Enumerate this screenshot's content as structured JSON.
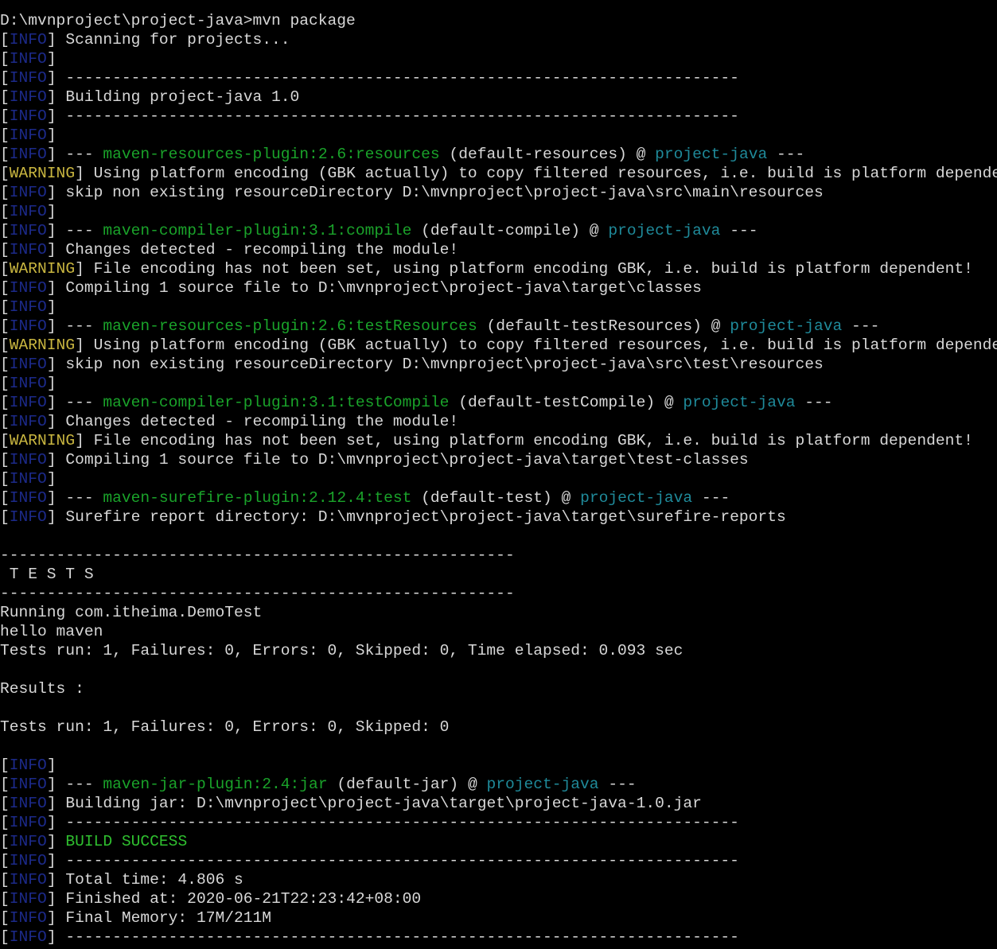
{
  "colors": {
    "default": "#d8d8d8",
    "info": "#1c2a8a",
    "warning": "#c9b640",
    "plugin": "#1aa32a",
    "project": "#1f8a9a",
    "success": "#2fbf2f"
  },
  "lines": [
    [
      {
        "t": "D:\\mvnproject\\project-java>mvn package",
        "c": "default"
      }
    ],
    [
      {
        "t": "[",
        "c": "default"
      },
      {
        "t": "INFO",
        "c": "info"
      },
      {
        "t": "] Scanning for projects...",
        "c": "default"
      }
    ],
    [
      {
        "t": "[",
        "c": "default"
      },
      {
        "t": "INFO",
        "c": "info"
      },
      {
        "t": "]",
        "c": "default"
      }
    ],
    [
      {
        "t": "[",
        "c": "default"
      },
      {
        "t": "INFO",
        "c": "info"
      },
      {
        "t": "] ------------------------------------------------------------------------",
        "c": "default"
      }
    ],
    [
      {
        "t": "[",
        "c": "default"
      },
      {
        "t": "INFO",
        "c": "info"
      },
      {
        "t": "] Building project-java 1.0",
        "c": "default"
      }
    ],
    [
      {
        "t": "[",
        "c": "default"
      },
      {
        "t": "INFO",
        "c": "info"
      },
      {
        "t": "] ------------------------------------------------------------------------",
        "c": "default"
      }
    ],
    [
      {
        "t": "[",
        "c": "default"
      },
      {
        "t": "INFO",
        "c": "info"
      },
      {
        "t": "]",
        "c": "default"
      }
    ],
    [
      {
        "t": "[",
        "c": "default"
      },
      {
        "t": "INFO",
        "c": "info"
      },
      {
        "t": "] --- ",
        "c": "default"
      },
      {
        "t": "maven-resources-plugin:2.6:resources",
        "c": "plugin"
      },
      {
        "t": " (default-resources) @ ",
        "c": "default"
      },
      {
        "t": "project-java",
        "c": "project"
      },
      {
        "t": " ---",
        "c": "default"
      }
    ],
    [
      {
        "t": "[",
        "c": "default"
      },
      {
        "t": "WARNING",
        "c": "warning"
      },
      {
        "t": "] Using platform encoding (GBK actually) to copy filtered resources, i.e. build is platform dependent!",
        "c": "default"
      }
    ],
    [
      {
        "t": "[",
        "c": "default"
      },
      {
        "t": "INFO",
        "c": "info"
      },
      {
        "t": "] skip non existing resourceDirectory D:\\mvnproject\\project-java\\src\\main\\resources",
        "c": "default"
      }
    ],
    [
      {
        "t": "[",
        "c": "default"
      },
      {
        "t": "INFO",
        "c": "info"
      },
      {
        "t": "]",
        "c": "default"
      }
    ],
    [
      {
        "t": "[",
        "c": "default"
      },
      {
        "t": "INFO",
        "c": "info"
      },
      {
        "t": "] --- ",
        "c": "default"
      },
      {
        "t": "maven-compiler-plugin:3.1:compile",
        "c": "plugin"
      },
      {
        "t": " (default-compile) @ ",
        "c": "default"
      },
      {
        "t": "project-java",
        "c": "project"
      },
      {
        "t": " ---",
        "c": "default"
      }
    ],
    [
      {
        "t": "[",
        "c": "default"
      },
      {
        "t": "INFO",
        "c": "info"
      },
      {
        "t": "] Changes detected - recompiling the module!",
        "c": "default"
      }
    ],
    [
      {
        "t": "[",
        "c": "default"
      },
      {
        "t": "WARNING",
        "c": "warning"
      },
      {
        "t": "] File encoding has not been set, using platform encoding GBK, i.e. build is platform dependent!",
        "c": "default"
      }
    ],
    [
      {
        "t": "[",
        "c": "default"
      },
      {
        "t": "INFO",
        "c": "info"
      },
      {
        "t": "] Compiling 1 source file to D:\\mvnproject\\project-java\\target\\classes",
        "c": "default"
      }
    ],
    [
      {
        "t": "[",
        "c": "default"
      },
      {
        "t": "INFO",
        "c": "info"
      },
      {
        "t": "]",
        "c": "default"
      }
    ],
    [
      {
        "t": "[",
        "c": "default"
      },
      {
        "t": "INFO",
        "c": "info"
      },
      {
        "t": "] --- ",
        "c": "default"
      },
      {
        "t": "maven-resources-plugin:2.6:testResources",
        "c": "plugin"
      },
      {
        "t": " (default-testResources) @ ",
        "c": "default"
      },
      {
        "t": "project-java",
        "c": "project"
      },
      {
        "t": " ---",
        "c": "default"
      }
    ],
    [
      {
        "t": "[",
        "c": "default"
      },
      {
        "t": "WARNING",
        "c": "warning"
      },
      {
        "t": "] Using platform encoding (GBK actually) to copy filtered resources, i.e. build is platform dependent!",
        "c": "default"
      }
    ],
    [
      {
        "t": "[",
        "c": "default"
      },
      {
        "t": "INFO",
        "c": "info"
      },
      {
        "t": "] skip non existing resourceDirectory D:\\mvnproject\\project-java\\src\\test\\resources",
        "c": "default"
      }
    ],
    [
      {
        "t": "[",
        "c": "default"
      },
      {
        "t": "INFO",
        "c": "info"
      },
      {
        "t": "]",
        "c": "default"
      }
    ],
    [
      {
        "t": "[",
        "c": "default"
      },
      {
        "t": "INFO",
        "c": "info"
      },
      {
        "t": "] --- ",
        "c": "default"
      },
      {
        "t": "maven-compiler-plugin:3.1:testCompile",
        "c": "plugin"
      },
      {
        "t": " (default-testCompile) @ ",
        "c": "default"
      },
      {
        "t": "project-java",
        "c": "project"
      },
      {
        "t": " ---",
        "c": "default"
      }
    ],
    [
      {
        "t": "[",
        "c": "default"
      },
      {
        "t": "INFO",
        "c": "info"
      },
      {
        "t": "] Changes detected - recompiling the module!",
        "c": "default"
      }
    ],
    [
      {
        "t": "[",
        "c": "default"
      },
      {
        "t": "WARNING",
        "c": "warning"
      },
      {
        "t": "] File encoding has not been set, using platform encoding GBK, i.e. build is platform dependent!",
        "c": "default"
      }
    ],
    [
      {
        "t": "[",
        "c": "default"
      },
      {
        "t": "INFO",
        "c": "info"
      },
      {
        "t": "] Compiling 1 source file to D:\\mvnproject\\project-java\\target\\test-classes",
        "c": "default"
      }
    ],
    [
      {
        "t": "[",
        "c": "default"
      },
      {
        "t": "INFO",
        "c": "info"
      },
      {
        "t": "]",
        "c": "default"
      }
    ],
    [
      {
        "t": "[",
        "c": "default"
      },
      {
        "t": "INFO",
        "c": "info"
      },
      {
        "t": "] --- ",
        "c": "default"
      },
      {
        "t": "maven-surefire-plugin:2.12.4:test",
        "c": "plugin"
      },
      {
        "t": " (default-test) @ ",
        "c": "default"
      },
      {
        "t": "project-java",
        "c": "project"
      },
      {
        "t": " ---",
        "c": "default"
      }
    ],
    [
      {
        "t": "[",
        "c": "default"
      },
      {
        "t": "INFO",
        "c": "info"
      },
      {
        "t": "] Surefire report directory: D:\\mvnproject\\project-java\\target\\surefire-reports",
        "c": "default"
      }
    ],
    [],
    [
      {
        "t": "-------------------------------------------------------",
        "c": "default"
      }
    ],
    [
      {
        "t": " T E S T S",
        "c": "default"
      }
    ],
    [
      {
        "t": "-------------------------------------------------------",
        "c": "default"
      }
    ],
    [
      {
        "t": "Running com.itheima.DemoTest",
        "c": "default"
      }
    ],
    [
      {
        "t": "hello maven",
        "c": "default"
      }
    ],
    [
      {
        "t": "Tests run: 1, Failures: 0, Errors: 0, Skipped: 0, Time elapsed: 0.093 sec",
        "c": "default"
      }
    ],
    [],
    [
      {
        "t": "Results :",
        "c": "default"
      }
    ],
    [],
    [
      {
        "t": "Tests run: 1, Failures: 0, Errors: 0, Skipped: 0",
        "c": "default"
      }
    ],
    [],
    [
      {
        "t": "[",
        "c": "default"
      },
      {
        "t": "INFO",
        "c": "info"
      },
      {
        "t": "]",
        "c": "default"
      }
    ],
    [
      {
        "t": "[",
        "c": "default"
      },
      {
        "t": "INFO",
        "c": "info"
      },
      {
        "t": "] --- ",
        "c": "default"
      },
      {
        "t": "maven-jar-plugin:2.4:jar",
        "c": "plugin"
      },
      {
        "t": " (default-jar) @ ",
        "c": "default"
      },
      {
        "t": "project-java",
        "c": "project"
      },
      {
        "t": " ---",
        "c": "default"
      }
    ],
    [
      {
        "t": "[",
        "c": "default"
      },
      {
        "t": "INFO",
        "c": "info"
      },
      {
        "t": "] Building jar: D:\\mvnproject\\project-java\\target\\project-java-1.0.jar",
        "c": "default"
      }
    ],
    [
      {
        "t": "[",
        "c": "default"
      },
      {
        "t": "INFO",
        "c": "info"
      },
      {
        "t": "] ------------------------------------------------------------------------",
        "c": "default"
      }
    ],
    [
      {
        "t": "[",
        "c": "default"
      },
      {
        "t": "INFO",
        "c": "info"
      },
      {
        "t": "] ",
        "c": "default"
      },
      {
        "t": "BUILD SUCCESS",
        "c": "success"
      }
    ],
    [
      {
        "t": "[",
        "c": "default"
      },
      {
        "t": "INFO",
        "c": "info"
      },
      {
        "t": "] ------------------------------------------------------------------------",
        "c": "default"
      }
    ],
    [
      {
        "t": "[",
        "c": "default"
      },
      {
        "t": "INFO",
        "c": "info"
      },
      {
        "t": "] Total time: 4.806 s",
        "c": "default"
      }
    ],
    [
      {
        "t": "[",
        "c": "default"
      },
      {
        "t": "INFO",
        "c": "info"
      },
      {
        "t": "] Finished at: 2020-06-21T22:23:42+08:00",
        "c": "default"
      }
    ],
    [
      {
        "t": "[",
        "c": "default"
      },
      {
        "t": "INFO",
        "c": "info"
      },
      {
        "t": "] Final Memory: 17M/211M",
        "c": "default"
      }
    ],
    [
      {
        "t": "[",
        "c": "default"
      },
      {
        "t": "INFO",
        "c": "info"
      },
      {
        "t": "] ------------------------------------------------------------------------",
        "c": "default"
      }
    ]
  ]
}
